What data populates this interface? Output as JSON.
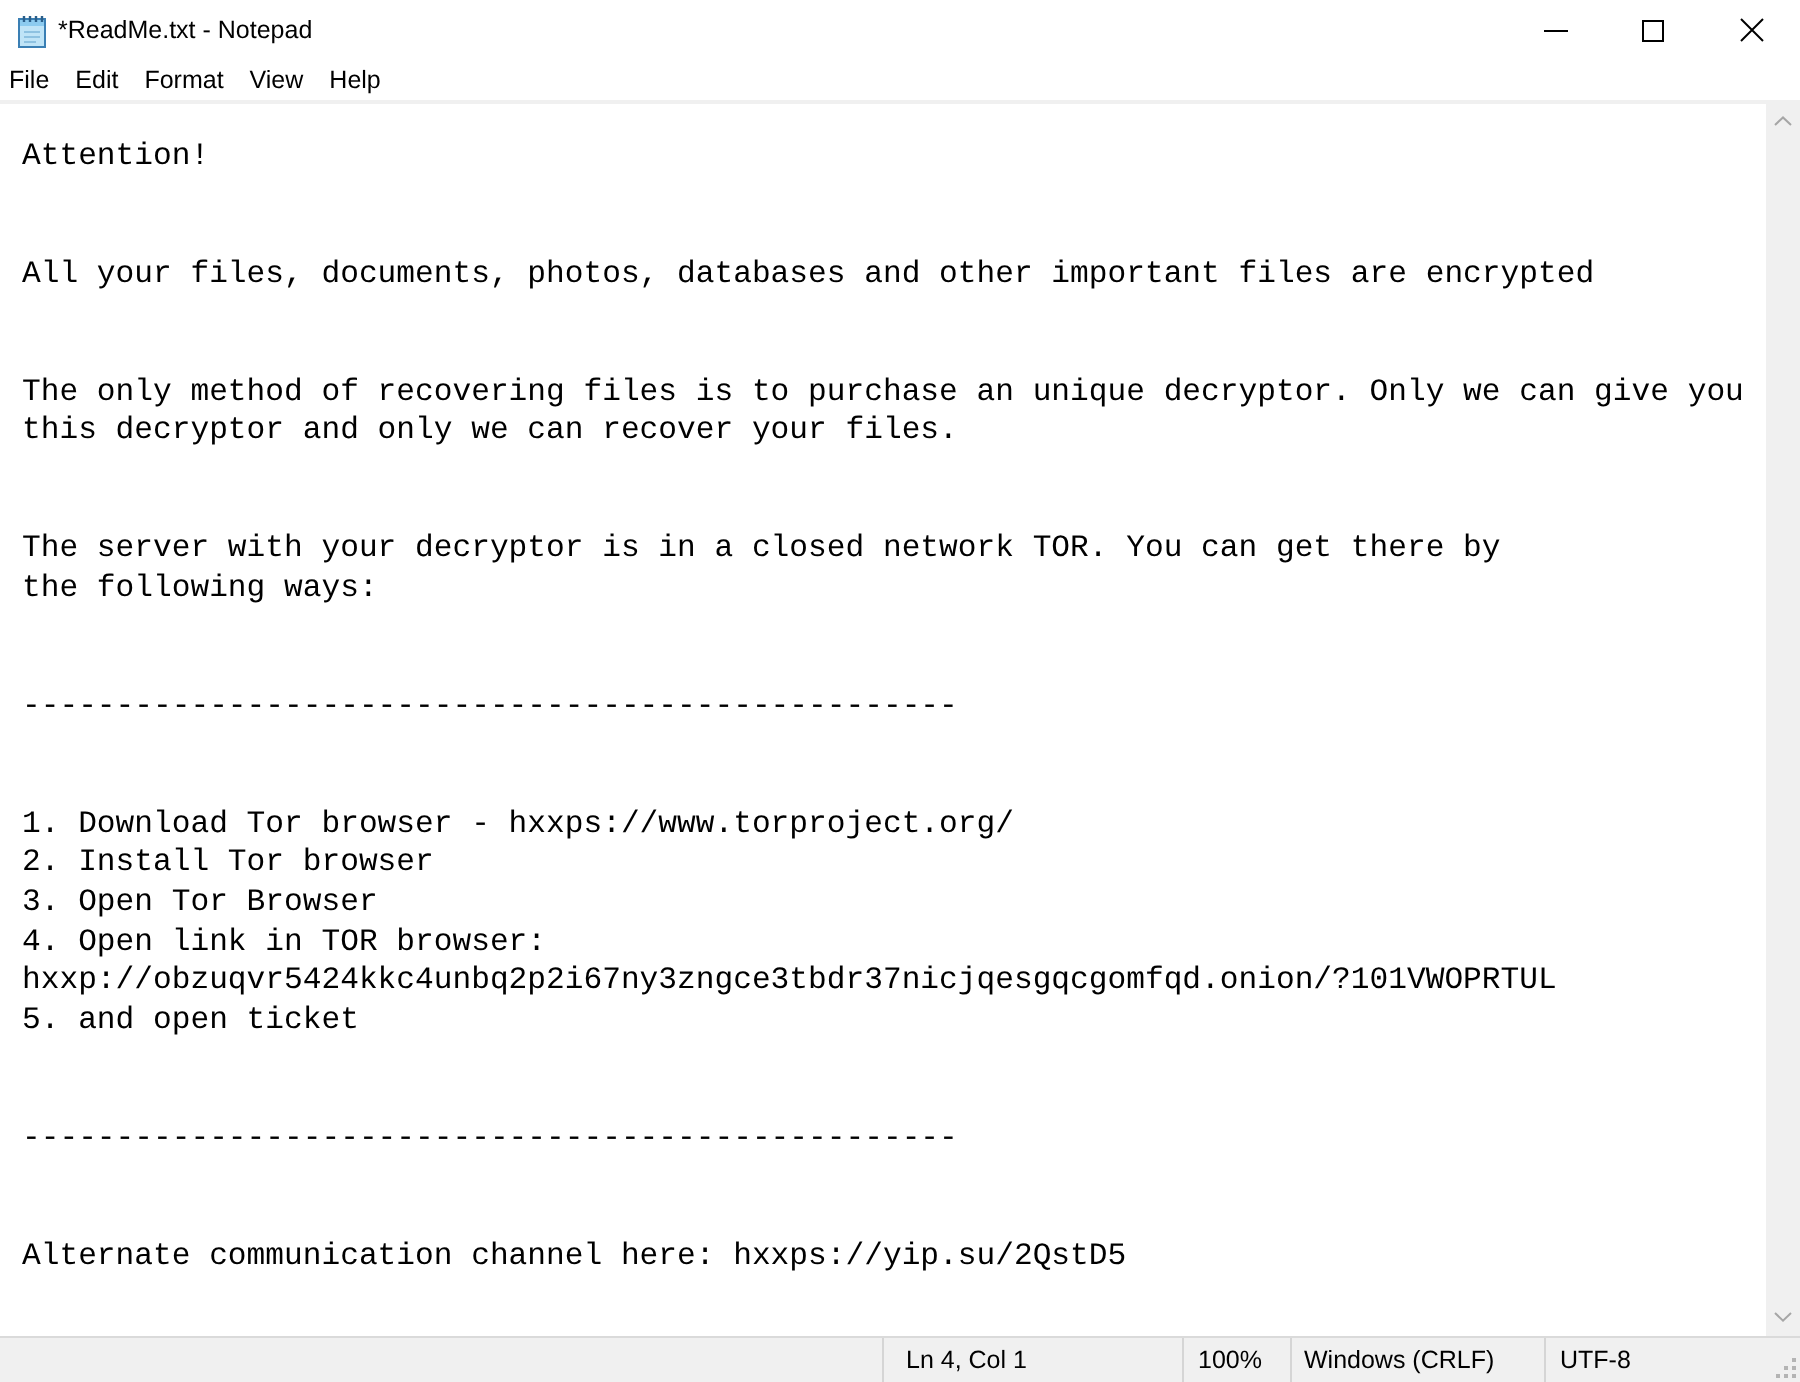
{
  "window": {
    "title": "*ReadMe.txt - Notepad"
  },
  "menu": [
    "File",
    "Edit",
    "Format",
    "View",
    "Help"
  ],
  "document": {
    "blocks": [
      {
        "lines": [
          "Attention!"
        ]
      },
      {
        "lines": [
          "All your files, documents, photos, databases and other important files are encrypted"
        ]
      },
      {
        "lines": [
          "The only method of recovering files is to purchase an unique decryptor. Only we can give you",
          "this decryptor and only we can recover your files."
        ]
      },
      {
        "lines": [
          "The server with your decryptor is in a closed network TOR. You can get there by",
          "the following ways:"
        ]
      },
      {
        "lines": [
          "--------------------------------------------------"
        ]
      },
      {
        "lines": [
          "1. Download Tor browser - hxxps://www.torproject.org/",
          "2. Install Tor browser",
          "3. Open Tor Browser",
          "4. Open link in TOR browser:",
          "hxxp://obzuqvr5424kkc4unbq2p2i67ny3zngce3tbdr37nicjqesgqcgomfqd.onion/?101VWOPRTUL",
          "5. and open ticket"
        ]
      },
      {
        "lines": [
          "--------------------------------------------------"
        ]
      },
      {
        "lines": [
          "Alternate communication channel here: hxxps://yip.su/2QstD5"
        ]
      }
    ]
  },
  "status_bar": {
    "position": "Ln 4, Col 1",
    "zoom": "100%",
    "line_endings": "Windows (CRLF)",
    "encoding": "UTF-8"
  }
}
